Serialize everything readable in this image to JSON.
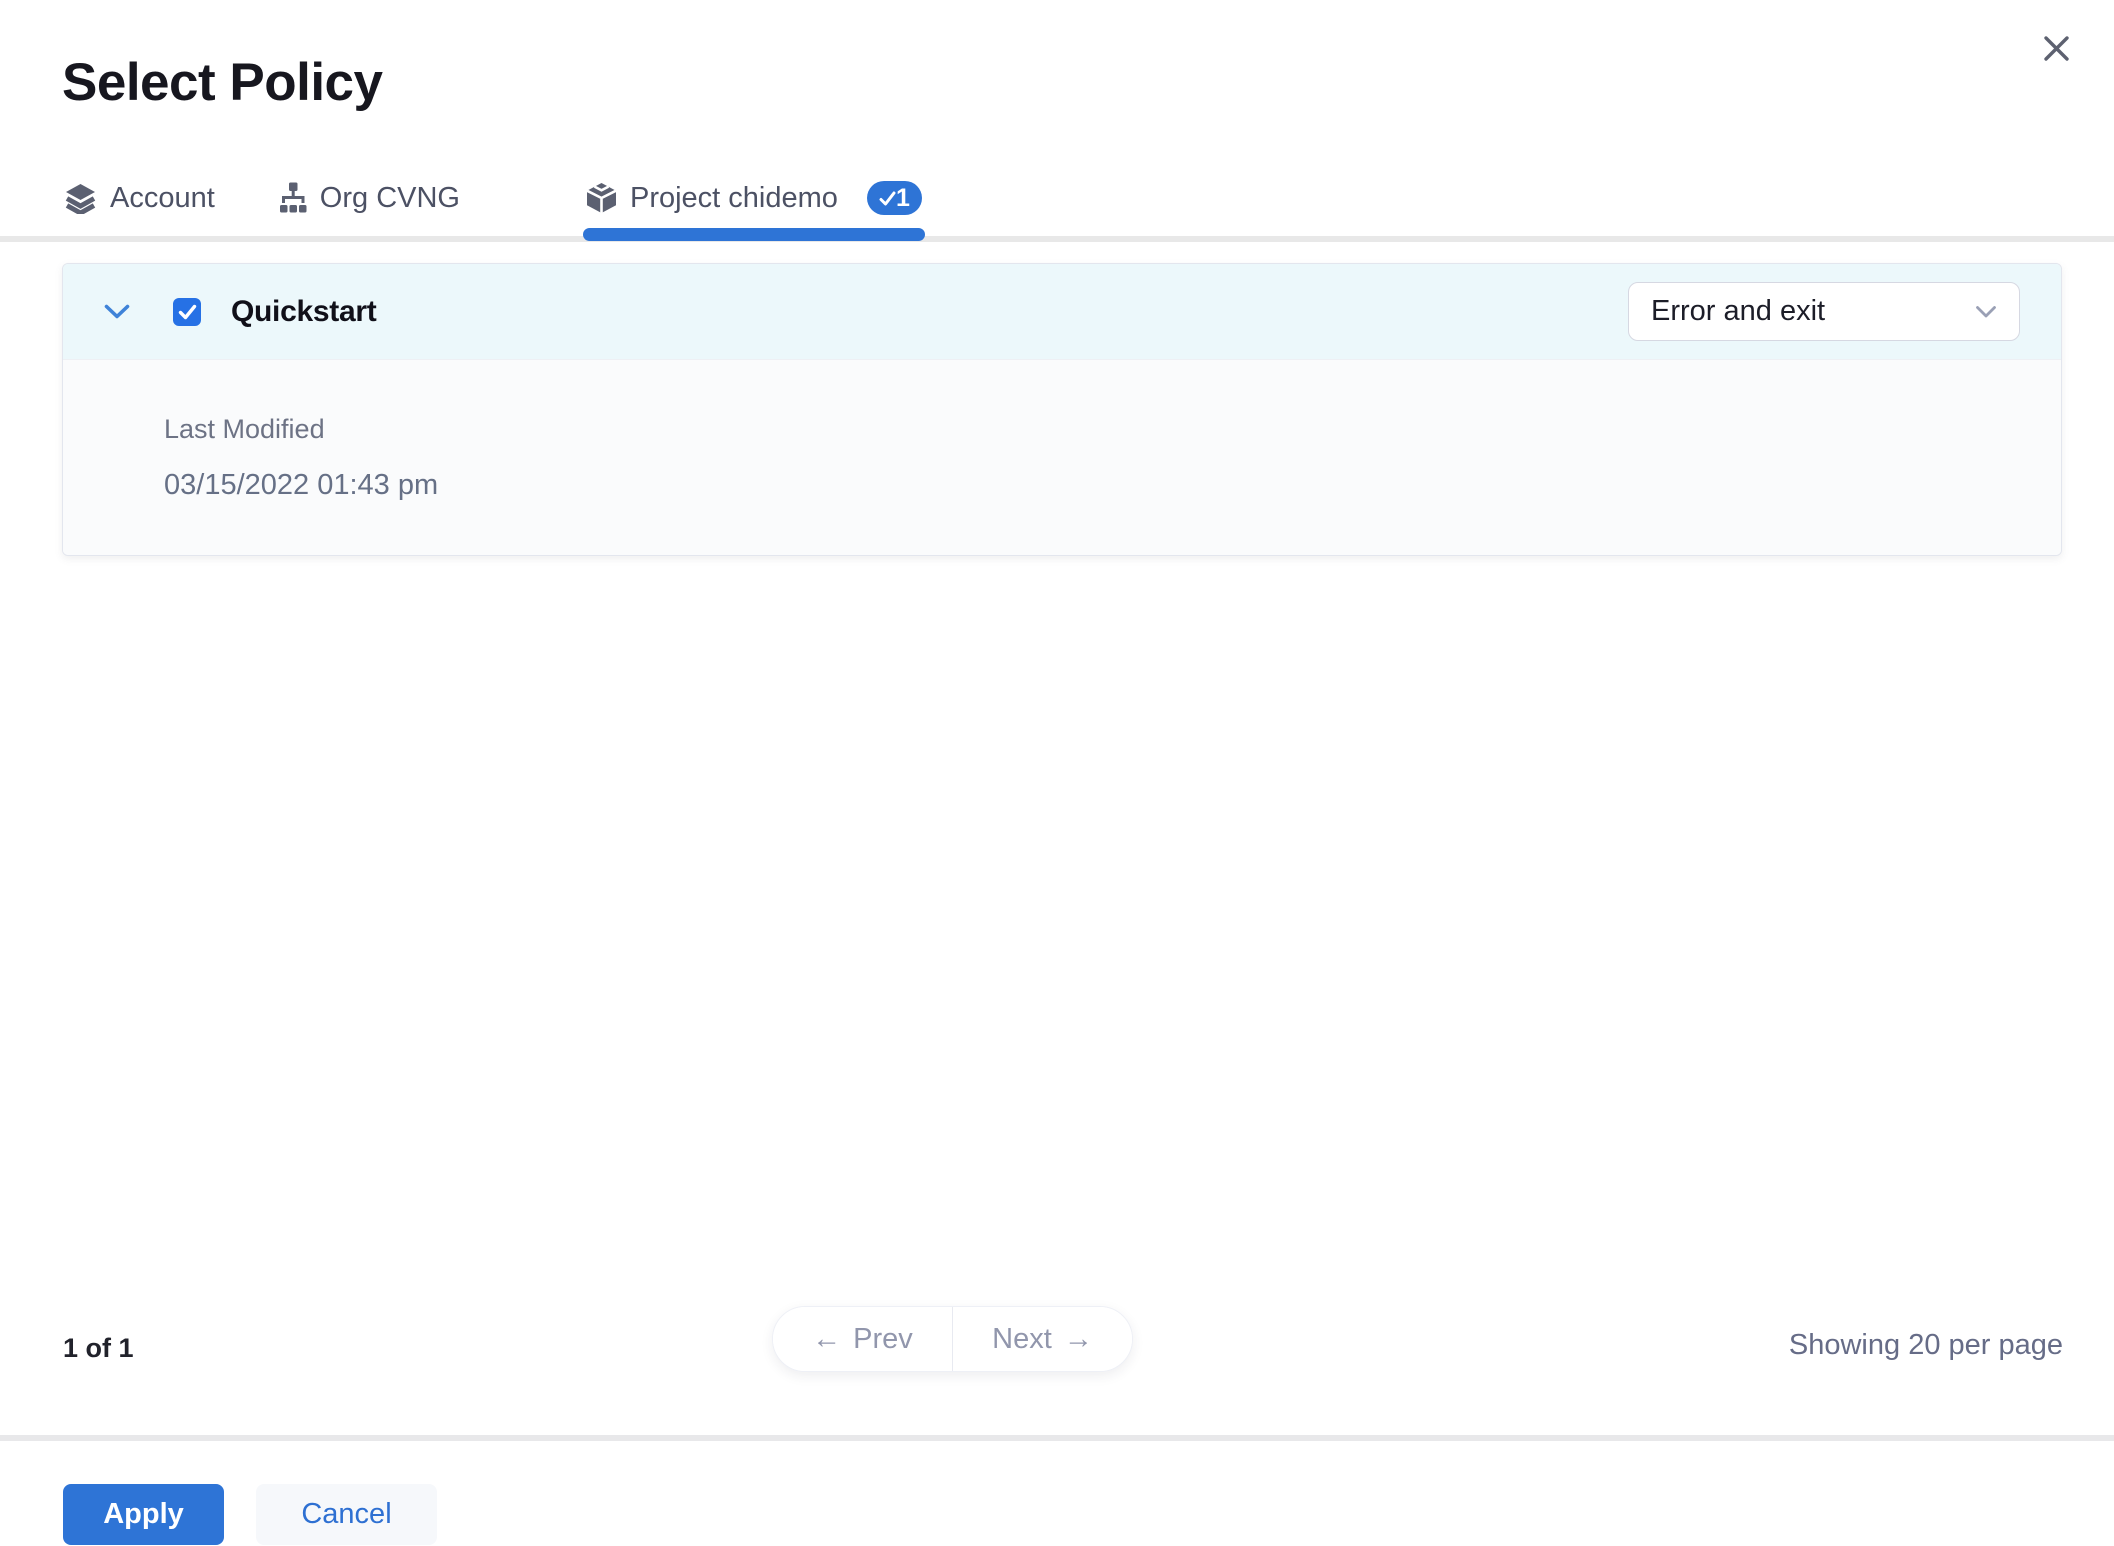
{
  "dialog": {
    "title": "Select Policy",
    "close_icon": "close-x"
  },
  "tabs": {
    "items": [
      {
        "label": "Account",
        "icon": "layers-icon",
        "active": false
      },
      {
        "label": "Org CVNG",
        "icon": "org-hierarchy-icon",
        "active": false
      },
      {
        "label": "Project chidemo",
        "icon": "cube-icon",
        "active": true,
        "badge": {
          "count": "1",
          "icon": "check-icon"
        }
      }
    ]
  },
  "policies": {
    "rows": [
      {
        "name": "Quickstart",
        "checked": true,
        "expanded": true,
        "expander_icon": "chevron-down-icon",
        "on_failure_action": "Error and exit",
        "select_icon": "chevron-down-icon",
        "details": {
          "last_modified_label": "Last Modified",
          "last_modified_value": "03/15/2022 01:43 pm"
        }
      }
    ]
  },
  "pagination": {
    "page_indicator": "1 of 1",
    "prev_arrow": "←",
    "prev_label": "Prev",
    "next_label": "Next",
    "next_arrow": "→",
    "per_page": "Showing 20 per page"
  },
  "footer": {
    "apply": "Apply",
    "cancel": "Cancel"
  },
  "colors": {
    "primary_blue": "#2E74D6",
    "checkbox_blue": "#2671E5",
    "row_header_bg": "#ECF8FB",
    "detail_bg": "#FAFBFC",
    "tab_text": "#4C5164",
    "muted_text": "#6D7385",
    "pager_text": "#9196AC",
    "divider_gray": "#E8E8E8"
  }
}
